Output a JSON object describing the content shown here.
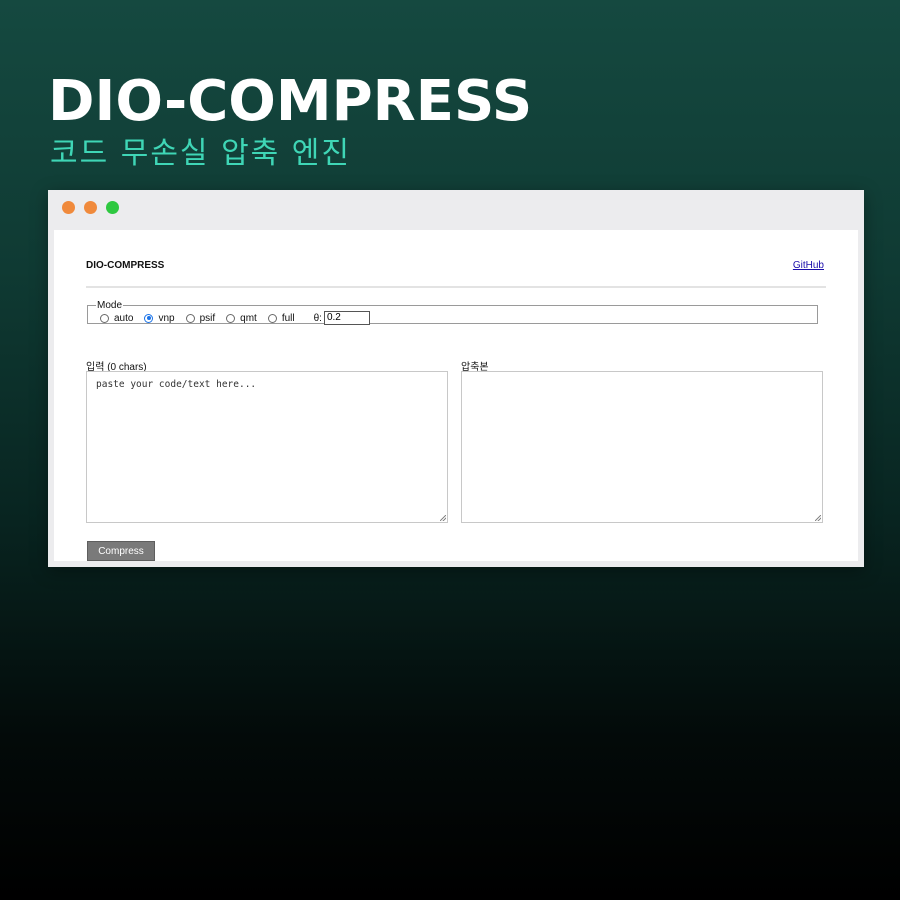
{
  "hero": {
    "title": "DIO-COMPRESS",
    "subtitle": "코드 무손실 압축 엔진"
  },
  "window": {
    "traffic_lights": [
      "#f08a3c",
      "#f08a3c",
      "#2ec840"
    ]
  },
  "app": {
    "brand": "DIO-COMPRESS",
    "github_link": "GitHub",
    "mode_legend": "Mode",
    "modes": [
      {
        "label": "auto",
        "checked": false
      },
      {
        "label": "vnp",
        "checked": true
      },
      {
        "label": "psif",
        "checked": false
      },
      {
        "label": "qmt",
        "checked": false
      },
      {
        "label": "full",
        "checked": false
      }
    ],
    "theta_label": "θ:",
    "theta_value": "0.2",
    "input_label": "입력",
    "input_count": "(0 chars)",
    "input_placeholder": "paste your code/text here...",
    "output_label": "압축본",
    "compress_button": "Compress"
  },
  "colors": {
    "accent_teal": "#3fd6b6",
    "radio_checked": "#1a73e8",
    "button_gray": "#7a7a7a"
  }
}
